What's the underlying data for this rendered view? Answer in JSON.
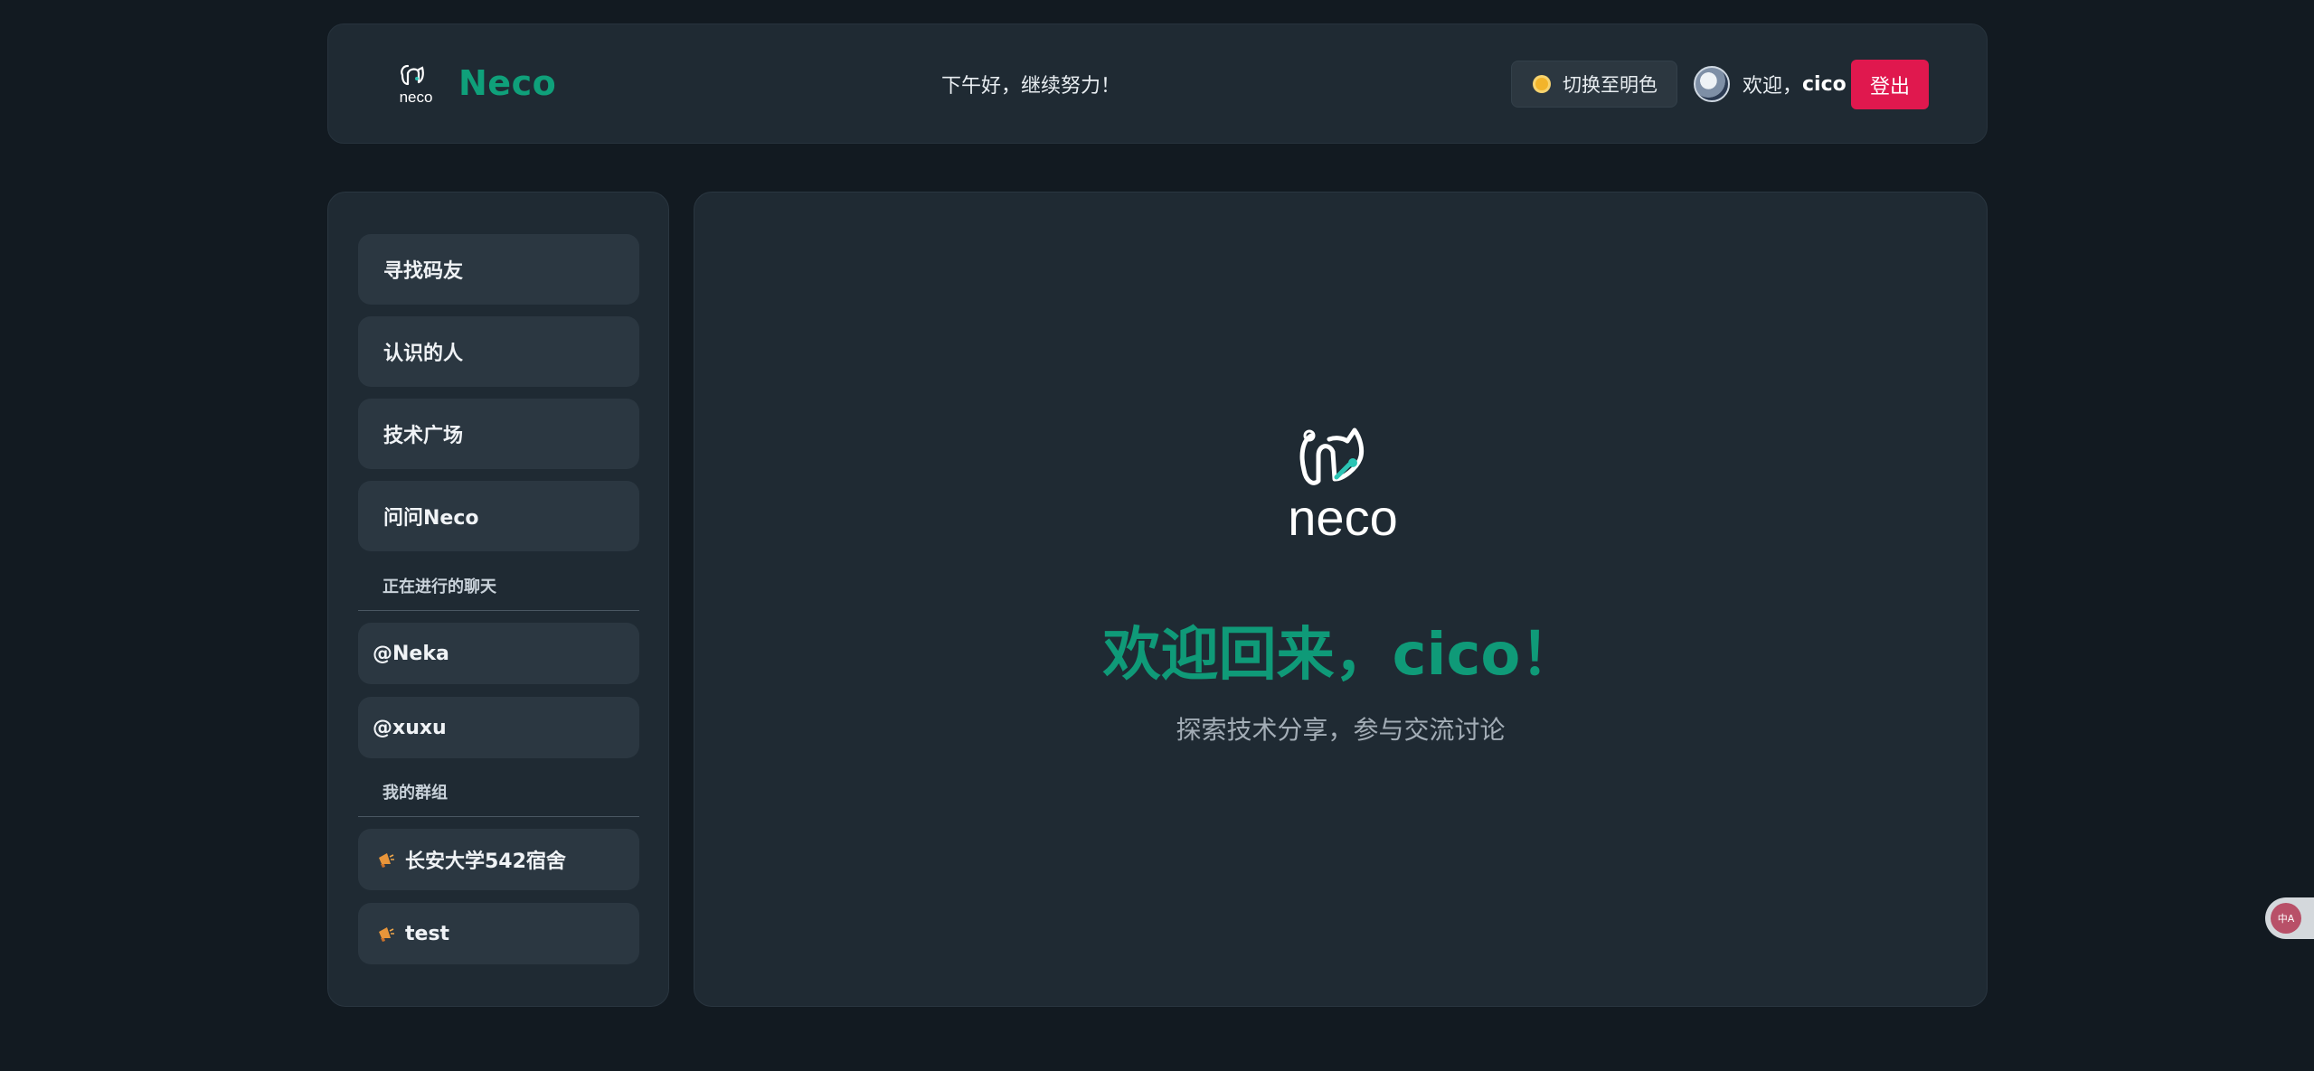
{
  "header": {
    "brand_logo_text": "neco",
    "brand_name": "Neco",
    "greeting": "下午好，继续努力！",
    "theme_toggle_label": "切换至明色",
    "welcome_prefix": "欢迎，",
    "username": "cico",
    "logout_label": "登出"
  },
  "sidebar": {
    "nav_items": [
      {
        "label": "寻找码友"
      },
      {
        "label": "认识的人"
      },
      {
        "label": "技术广场"
      },
      {
        "label": "问问Neco"
      }
    ],
    "active_chats_label": "正在进行的聊天",
    "active_chats": [
      {
        "label": "@Neka"
      },
      {
        "label": "@xuxu"
      }
    ],
    "groups_label": "我的群组",
    "groups": [
      {
        "label": "长安大学542宿舍",
        "icon": "megaphone-icon"
      },
      {
        "label": "test",
        "icon": "megaphone-icon"
      }
    ]
  },
  "main": {
    "logo_text": "neco",
    "title": "欢迎回来，cico！",
    "subtitle": "探索技术分享，参与交流讨论"
  },
  "widget": {
    "translate_text": "中A"
  },
  "colors": {
    "accent": "#0f9a78",
    "logout": "#e0184e",
    "background": "#121a21",
    "panel": "#1f2a33",
    "item": "#2b3741"
  }
}
